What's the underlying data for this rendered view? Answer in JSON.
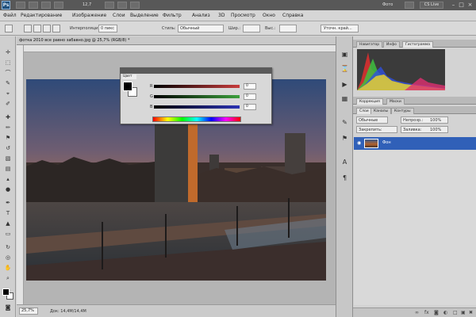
{
  "appbar": {
    "logo": "Ps",
    "zoom_value": "12,7",
    "workspace_label": "Фото",
    "cs_live_label": "CS Live",
    "window_controls": [
      "minimize-icon",
      "restore-icon",
      "close-icon"
    ]
  },
  "menu": {
    "items": [
      "Файл",
      "Редактирование",
      "Изображение",
      "Слои",
      "Выделение",
      "Фильтр",
      "Анализ",
      "3D",
      "Просмотр",
      "Окно",
      "Справка"
    ]
  },
  "options": {
    "tool_label": "Интерполяция:",
    "tool_value": "0 пикс",
    "style_label": "Стиль:",
    "style_value": "Обычный",
    "width_label": "Шир.:",
    "height_label": "Выс.:",
    "refine_button": "Уточн. край..."
  },
  "document": {
    "title": "фотка 2010 все равно забавно.jpg @ 25,7% (RGB/8) *",
    "zoom": "25,7%",
    "status": "Док: 14,4M/14,4M"
  },
  "color_panel": {
    "tab": "Цвет",
    "channels": [
      {
        "label": "R",
        "value": "0",
        "color": "#c83c3c"
      },
      {
        "label": "G",
        "value": "0",
        "color": "#3ca03c"
      },
      {
        "label": "B",
        "value": "0",
        "color": "#2a32b4"
      }
    ]
  },
  "histogram_panel": {
    "tabs": [
      "Навигатор",
      "Инфо",
      "Гистограмма"
    ]
  },
  "layers_panel": {
    "tabs": [
      "Коррекция",
      "Маски"
    ],
    "subtabs": [
      "Слои",
      "Каналы",
      "Контуры"
    ],
    "blend_mode": "Обычные",
    "opacity_label": "Непрозр.:",
    "opacity_value": "100%",
    "fill_label": "Заливка:",
    "fill_value": "100%",
    "lock_label": "Закрепить:",
    "layer_name": "Фон"
  },
  "colors": {
    "selection_blue": "#3060b8",
    "app_bar": "#585858"
  }
}
